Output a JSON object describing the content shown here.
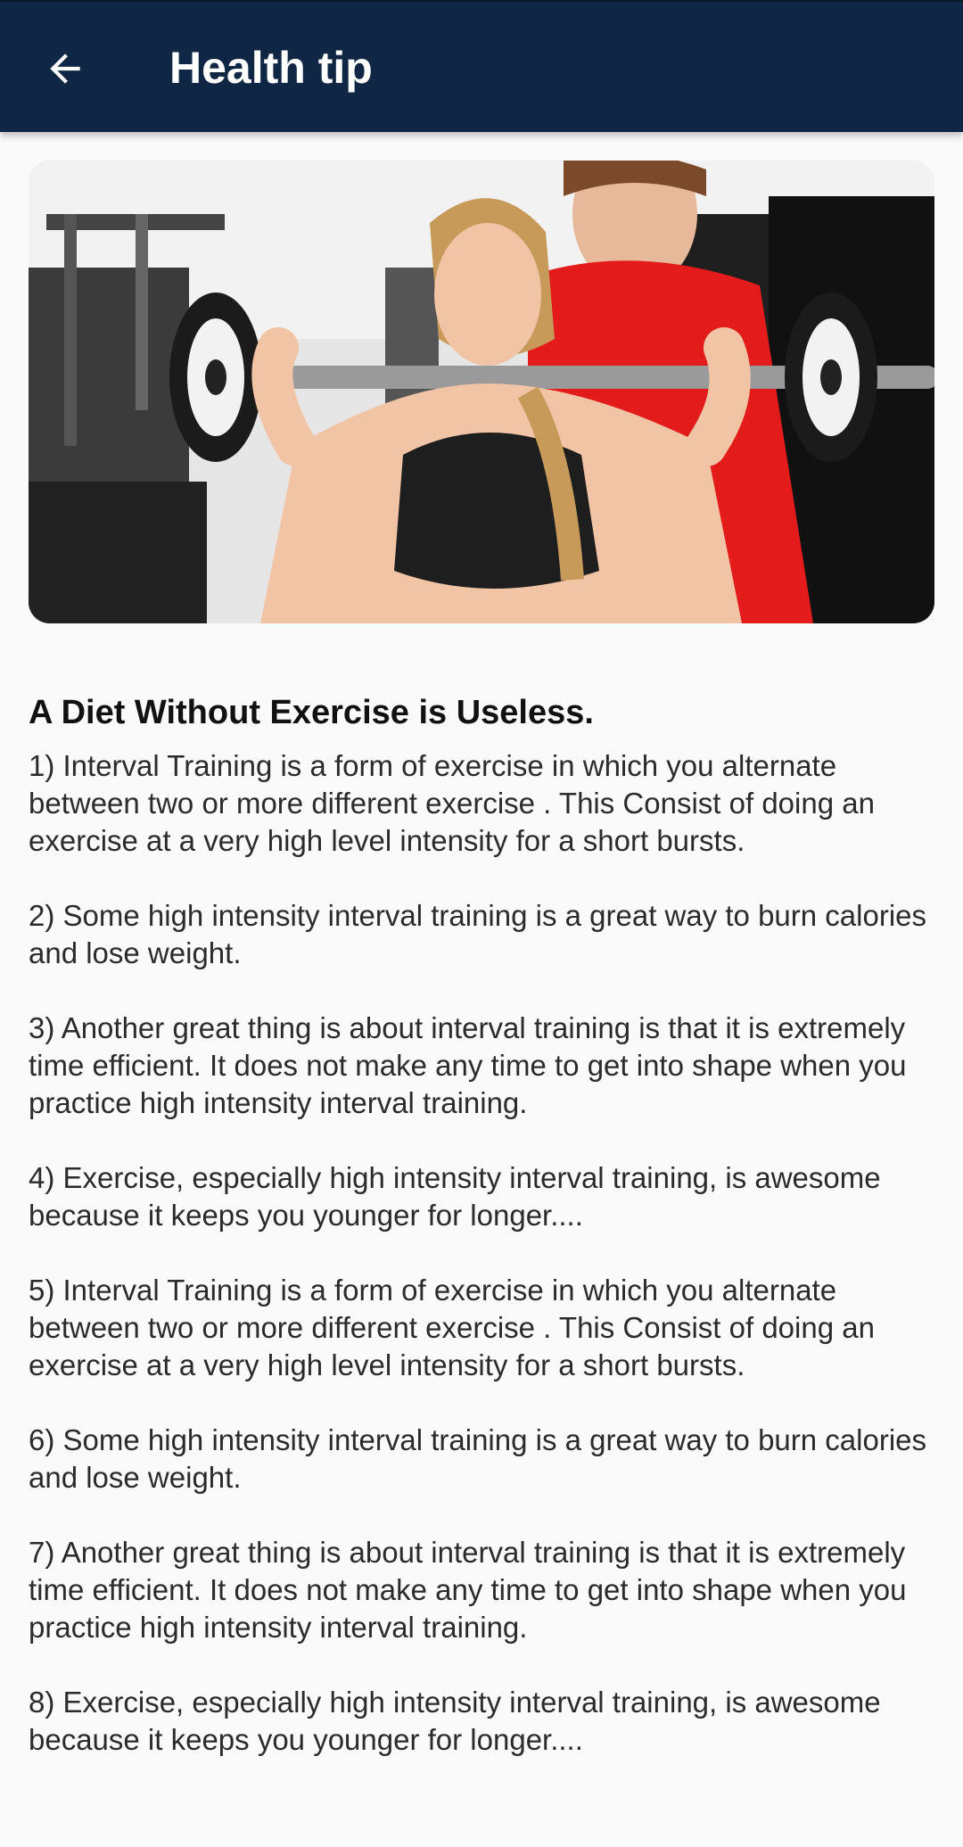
{
  "app_bar": {
    "title": "Health tip",
    "back_icon": "arrow-back-icon",
    "background": "#0f2744"
  },
  "hero_image": {
    "description_icon": "fitness-photo"
  },
  "article": {
    "headline": "A Diet Without Exercise is Useless.",
    "paragraphs": [
      "1) Interval Training is a form of exercise in which you alternate between two or more different exercise . This Consist of doing an exercise at a very high  level intensity for a short bursts.",
      "2) Some high intensity interval training is a great way to burn calories and lose weight.",
      "3) Another great thing is about interval training is that it is extremely time efficient. It does not make any time to get into shape when you practice high intensity interval training.",
      "4) Exercise, especially high intensity interval training, is awesome because it keeps you younger for longer....",
      "5) Interval Training is a form of exercise in which you alternate between two or more different exercise . This Consist of doing an exercise at a very high  level intensity for a short bursts.",
      "6) Some high intensity interval training is a great way to burn calories and lose weight.",
      "7) Another great thing is about interval training is that it is extremely time efficient. It does not make any time to get into shape when you practice high intensity interval training.",
      "8) Exercise, especially high intensity interval training, is awesome because it keeps you younger for longer...."
    ]
  }
}
